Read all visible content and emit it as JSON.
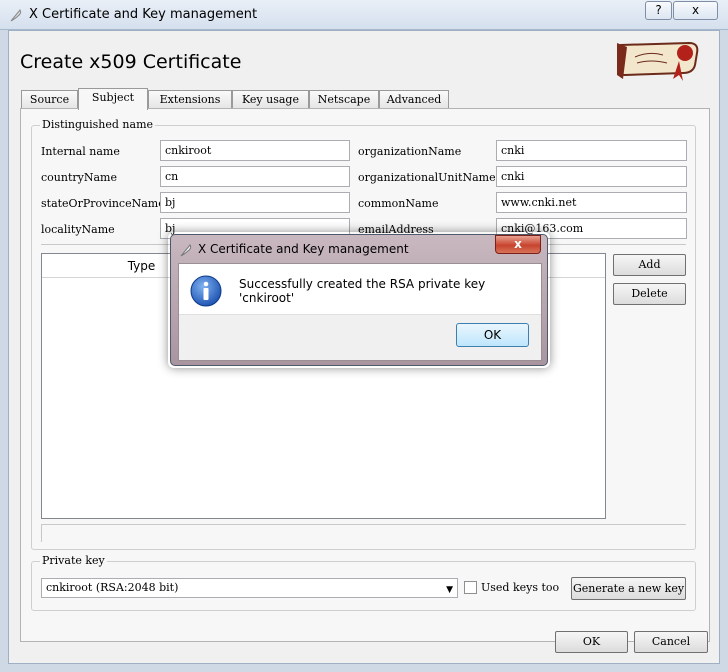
{
  "window": {
    "title": "X Certificate and Key management",
    "help_label": "?",
    "close_label": "x"
  },
  "page": {
    "heading": "Create x509 Certificate"
  },
  "tabs": [
    {
      "label": "Source",
      "active": false
    },
    {
      "label": "Subject",
      "active": true
    },
    {
      "label": "Extensions",
      "active": false
    },
    {
      "label": "Key usage",
      "active": false
    },
    {
      "label": "Netscape",
      "active": false
    },
    {
      "label": "Advanced",
      "active": false
    }
  ],
  "distinguished_name": {
    "group_label": "Distinguished name",
    "fields": [
      {
        "label": "Internal name",
        "value": "cnkiroot"
      },
      {
        "label": "organizationName",
        "value": "cnki"
      },
      {
        "label": "countryName",
        "value": "cn"
      },
      {
        "label": "organizationalUnitName",
        "value": "cnki"
      },
      {
        "label": "stateOrProvinceName",
        "value": "bj"
      },
      {
        "label": "commonName",
        "value": "www.cnki.net"
      },
      {
        "label": "localityName",
        "value": "bj"
      },
      {
        "label": "emailAddress",
        "value": "cnki@163.com"
      }
    ],
    "table_header_type": "Type",
    "add_label": "Add",
    "delete_label": "Delete"
  },
  "private_key": {
    "group_label": "Private key",
    "selected": "cnkiroot (RSA:2048 bit)",
    "used_keys_label": "Used keys too",
    "generate_label": "Generate a new key"
  },
  "footer": {
    "ok_label": "OK",
    "cancel_label": "Cancel"
  },
  "dialog": {
    "title": "X Certificate and Key management",
    "close_label": "x",
    "message": "Successfully created the RSA private key 'cnkiroot'",
    "ok_label": "OK",
    "icon": "info-icon"
  }
}
